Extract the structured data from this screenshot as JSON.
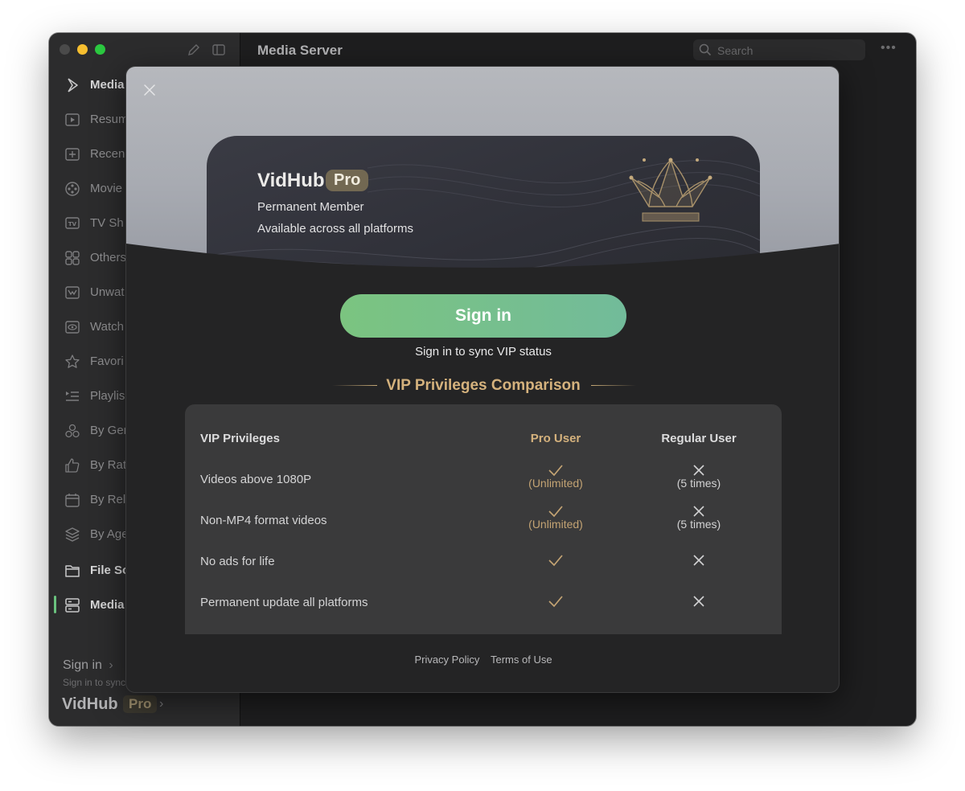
{
  "window": {
    "title": "Media Server"
  },
  "search": {
    "placeholder": "Search"
  },
  "sidebar": {
    "items": [
      {
        "label": "Media",
        "icon": "media-play-icon",
        "type": "head"
      },
      {
        "label": "Resum",
        "icon": "resume-icon",
        "type": "item"
      },
      {
        "label": "Recen",
        "icon": "recent-icon",
        "type": "item"
      },
      {
        "label": "Movie",
        "icon": "movie-reel-icon",
        "type": "item"
      },
      {
        "label": "TV Sh",
        "icon": "tv-icon",
        "type": "item"
      },
      {
        "label": "Others",
        "icon": "grid-icon",
        "type": "item"
      },
      {
        "label": "Unwat",
        "icon": "unwatched-icon",
        "type": "item"
      },
      {
        "label": "Watch",
        "icon": "watched-eye-icon",
        "type": "item"
      },
      {
        "label": "Favori",
        "icon": "star-icon",
        "type": "item"
      },
      {
        "label": "Playlis",
        "icon": "playlist-icon",
        "type": "item"
      },
      {
        "label": "By Ger",
        "icon": "genre-icon",
        "type": "item"
      },
      {
        "label": "By Rat",
        "icon": "thumbs-up-icon",
        "type": "item"
      },
      {
        "label": "By Rel",
        "icon": "calendar-icon",
        "type": "item"
      },
      {
        "label": "By Age",
        "icon": "layers-icon",
        "type": "item"
      },
      {
        "label": "File So",
        "icon": "folder-icon",
        "type": "head"
      },
      {
        "label": "Media",
        "icon": "server-icon",
        "type": "head-active"
      }
    ],
    "signin_label": "Sign in",
    "signin_sub": "Sign in to sync",
    "brand": "VidHub",
    "brand_badge": "Pro"
  },
  "modal": {
    "card": {
      "title": "VidHub",
      "badge": "Pro",
      "line1": "Permanent Member",
      "line2": "Available across all platforms"
    },
    "signin_button": "Sign in",
    "signin_subtitle": "Sign in to sync VIP status",
    "comparison_title": "VIP Privileges Comparison",
    "table": {
      "headers": [
        "VIP Privileges",
        "Pro User",
        "Regular User"
      ],
      "rows": [
        {
          "name": "Videos above 1080P",
          "pro_note": "(Unlimited)",
          "regular_note": "(5 times)"
        },
        {
          "name": "Non-MP4 format videos",
          "pro_note": "(Unlimited)",
          "regular_note": "(5 times)"
        },
        {
          "name": "No ads for life",
          "pro_note": "",
          "regular_note": ""
        },
        {
          "name": "Permanent update all platforms",
          "pro_note": "",
          "regular_note": ""
        }
      ]
    },
    "footer": {
      "privacy": "Privacy Policy",
      "terms": "Terms of Use"
    }
  },
  "colors": {
    "accent_gold": "#d5b27d",
    "signin_green": "#7bc480",
    "active_indicator": "#6ac27e"
  }
}
